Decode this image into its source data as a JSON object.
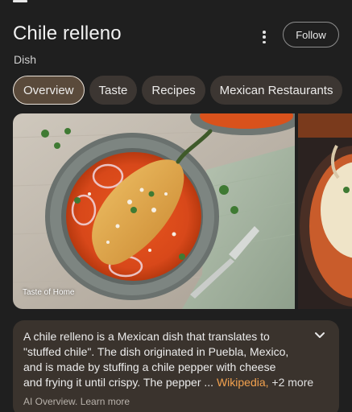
{
  "header": {
    "title": "Chile relleno",
    "subtitle": "Dish",
    "follow_label": "Follow"
  },
  "tabs": [
    {
      "label": "Overview",
      "active": true
    },
    {
      "label": "Taste",
      "active": false
    },
    {
      "label": "Recipes",
      "active": false
    },
    {
      "label": "Mexican Restaurants",
      "active": false
    }
  ],
  "images": {
    "main_credit": "Taste of Home"
  },
  "overview": {
    "text_main": "A chile relleno is a Mexican dish that translates to \"stuffed chile\". The dish originated in Puebla, Mexico, and is made by stuffing a chile pepper with cheese",
    "text_cont": "and frying it until crispy. The pepper ...",
    "source_label": "Wikipedia,",
    "more_label": "+2 more",
    "ai_label": "AI Overview.",
    "learn_more": "Learn more"
  },
  "colors": {
    "background": "#1f1f1f",
    "tab_bg": "#3c3632",
    "tab_active_bg": "#5a4a3b",
    "card_bg": "#3a332d",
    "link_orange": "#f2a14e"
  },
  "icons": {
    "menu": "menu-icon",
    "more": "more-vert-icon",
    "expand": "chevron-down-icon"
  }
}
